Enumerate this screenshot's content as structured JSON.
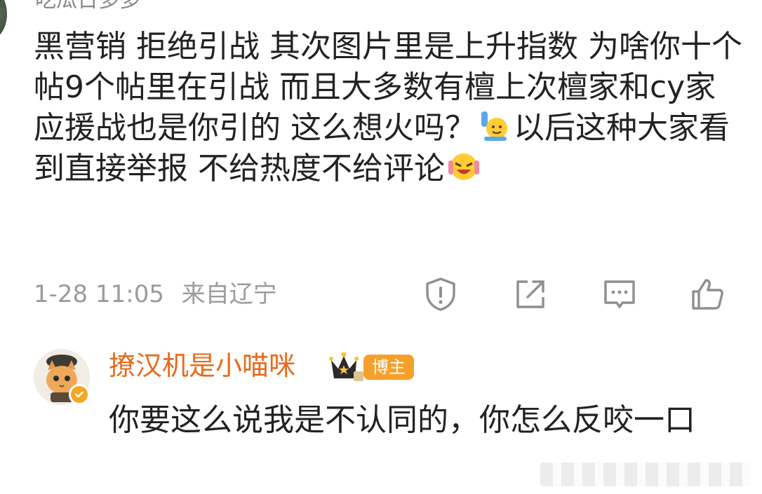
{
  "top_comment": {
    "username": "吃瓜日多多",
    "text": "黑营销 拒绝引战 其次图片里是上升指数 为啥你十个帖9个帖里在引战 而且大多数有檀上次檀家和cy家应援战也是你引的 这么想火吗？",
    "text_after_emoji": "以后这种大家看到直接举报 不给热度不给评论",
    "emoji_1": "raising-hand-emoji",
    "emoji_2": "crying-laughing-emoji",
    "time": "1-28 11:05",
    "location": "来自辽宁",
    "actions": [
      "report-icon",
      "share-icon",
      "comment-icon",
      "like-icon"
    ]
  },
  "reply": {
    "username": "撩汉机是小喵咪",
    "badge": "博主",
    "text": "你要这么说我是不认同的，你怎么反咬一口"
  },
  "colors": {
    "username_orange": "#e86a1a",
    "badge_bg": "#f6a02b",
    "meta_gray": "#9b9b9b"
  }
}
